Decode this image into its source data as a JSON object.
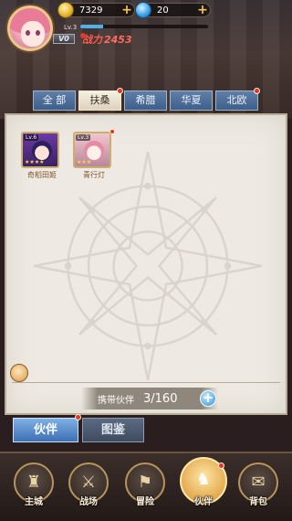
{
  "header": {
    "level": "Lv.3",
    "exp_fraction": 0.18,
    "vip": "V0",
    "power_label": "战力",
    "power_value": "2453",
    "gold": "7329",
    "gems": "20"
  },
  "tabs": [
    {
      "label": "全 部",
      "active": false,
      "badge": false
    },
    {
      "label": "扶桑",
      "active": true,
      "badge": true
    },
    {
      "label": "希腊",
      "active": false,
      "badge": false
    },
    {
      "label": "华夏",
      "active": false,
      "badge": false
    },
    {
      "label": "北欧",
      "active": false,
      "badge": true
    }
  ],
  "partners": [
    {
      "name": "奇稻田姬",
      "level": "Lv.6",
      "stars": "★★★★",
      "badge": false
    },
    {
      "name": "青行灯",
      "level": "Lv.3",
      "stars": "★★★",
      "badge": true
    }
  ],
  "carry": {
    "label": "携带伙伴",
    "value": "3/160"
  },
  "subtabs": {
    "partner": "伙伴",
    "atlas": "图鉴"
  },
  "nav": [
    {
      "label": "主城",
      "icon": "castle-icon",
      "active": false
    },
    {
      "label": "战场",
      "icon": "battle-icon",
      "active": false
    },
    {
      "label": "冒险",
      "icon": "adventure-icon",
      "active": false
    },
    {
      "label": "伙伴",
      "icon": "partner-icon",
      "active": true
    },
    {
      "label": "背包",
      "icon": "bag-icon",
      "active": false
    }
  ],
  "colors": {
    "accent_blue": "#3d6fb4",
    "power_red": "#ff5b4d",
    "badge_red": "#e1352b"
  }
}
